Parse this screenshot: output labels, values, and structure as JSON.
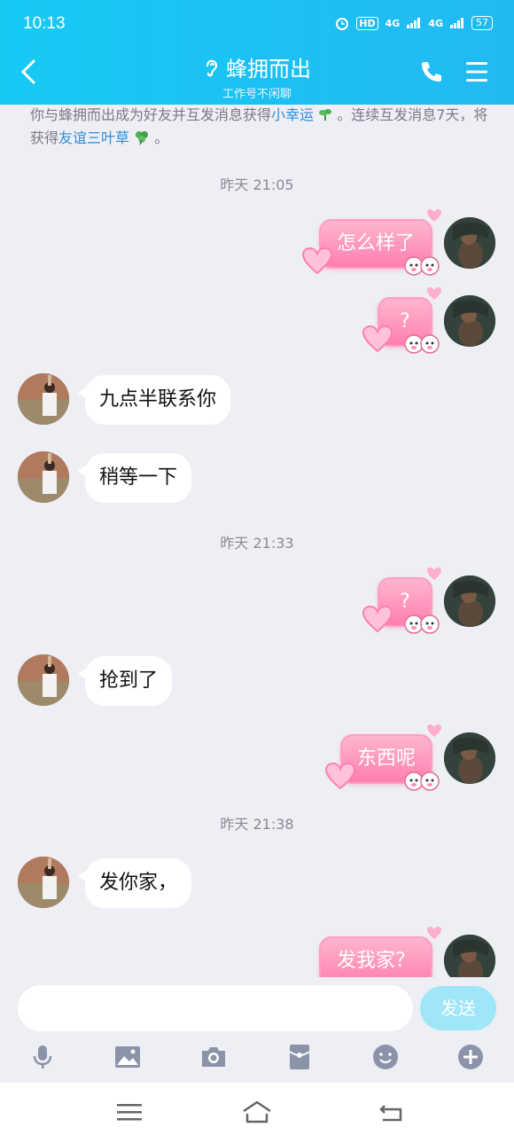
{
  "status_bar": {
    "time": "10:13",
    "network_1": "HD",
    "sig_1": "4G",
    "sig_2": "4G",
    "battery": "57"
  },
  "header": {
    "title": "蜂拥而出",
    "subtitle": "工作号不闲聊"
  },
  "system_note": {
    "part1": "你与蜂拥而出成为好友并互发消息获得",
    "link1": "小幸运",
    "part2": " 。连续互发消息7天，将获得",
    "link2": "友谊三叶草",
    "part3": " 。"
  },
  "messages": [
    {
      "type": "time",
      "text": "昨天 21:05"
    },
    {
      "type": "sent",
      "text": "怎么样了"
    },
    {
      "type": "sent",
      "text": "?"
    },
    {
      "type": "received",
      "text": "九点半联系你"
    },
    {
      "type": "received",
      "text": "稍等一下"
    },
    {
      "type": "time",
      "text": "昨天 21:33"
    },
    {
      "type": "sent",
      "text": "?"
    },
    {
      "type": "received",
      "text": "抢到了"
    },
    {
      "type": "sent",
      "text": "东西呢"
    },
    {
      "type": "time",
      "text": "昨天 21:38"
    },
    {
      "type": "received",
      "text": "发你家，"
    },
    {
      "type": "sent",
      "text": "发我家？"
    }
  ],
  "input": {
    "placeholder": "",
    "send_label": "发送"
  },
  "toolbar": [
    "microphone-icon",
    "image-icon",
    "camera-icon",
    "red-packet-icon",
    "emoji-icon",
    "plus-icon"
  ],
  "colors": {
    "header": "#16c9f5",
    "link": "#2e8fd8",
    "bubble_sent": "#ff7fae",
    "background": "#eeeef5"
  }
}
